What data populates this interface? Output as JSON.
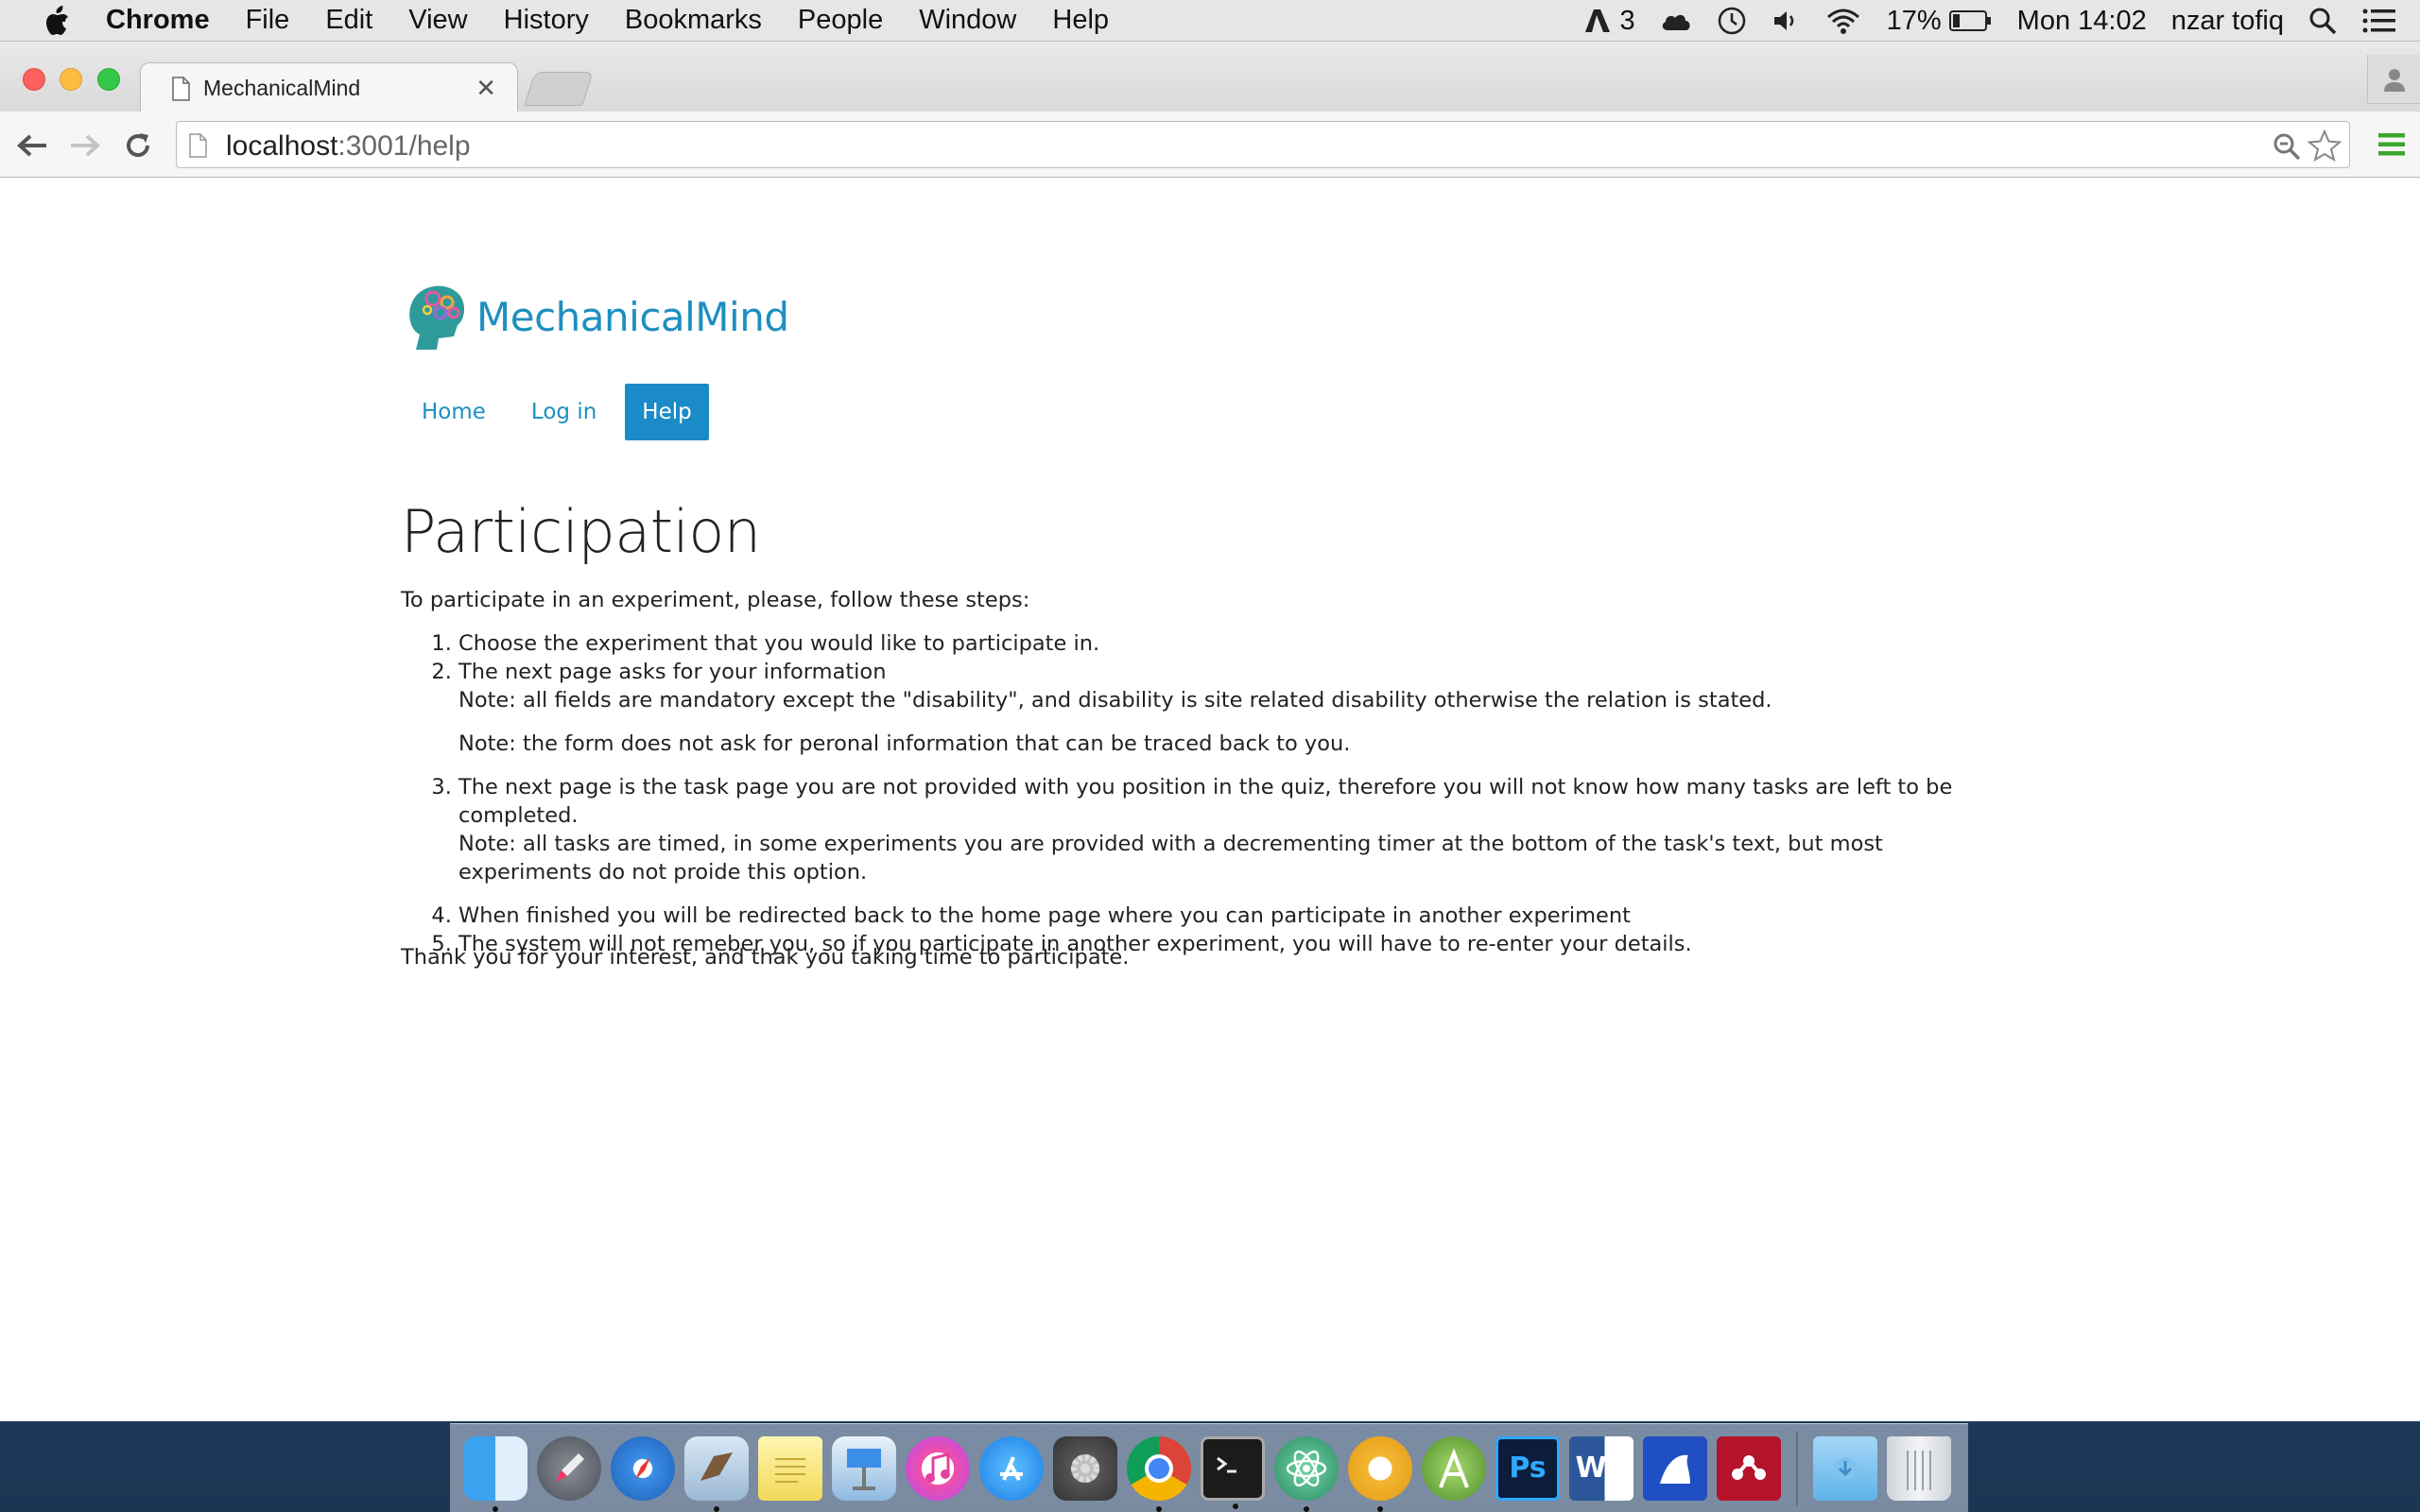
{
  "menubar": {
    "app": "Chrome",
    "items": [
      "File",
      "Edit",
      "View",
      "History",
      "Bookmarks",
      "People",
      "Window",
      "Help"
    ],
    "adobe_count": "3",
    "battery": "17%",
    "clock": "Mon 14:02",
    "user": "nzar tofiq"
  },
  "browser": {
    "tab_title": "MechanicalMind",
    "url_host": "localhost",
    "url_path": ":3001/help"
  },
  "page": {
    "brand": "MechanicalMind",
    "nav": [
      "Home",
      "Log in",
      "Help"
    ],
    "heading": "Participation",
    "intro": "To participate in an experiment, please, follow these steps:",
    "steps": {
      "s1": "Choose the experiment that you would like to participate in.",
      "s2": "The next page asks for your information",
      "s2_note1": "Note: all fields are mandatory except the \"disability\", and disability is site related disability otherwise the relation is stated.",
      "s2_note2": "Note: the form does not ask for peronal information that can be traced back to you.",
      "s3": "The next page is the task page you are not provided with you position in the quiz, therefore you will not know how many tasks are left to be completed.",
      "s3_note": "Note: all tasks are timed, in some experiments you are provided with a decrementing timer at the bottom of the task's text, but most experiments do not proide this option.",
      "s4": "When finished you will be redirected back to the home page where you can participate in another experiment",
      "s5": "The system will not remeber you, so if you participate in another experiment, you will have to re-enter your details."
    },
    "thanks": "Thank you for your interest, and thak you taking time to participate."
  },
  "dock": {
    "apps": [
      "finder-icon",
      "launchpad-icon",
      "safari-icon",
      "mail-icon",
      "notes-icon",
      "keynote-icon",
      "itunes-icon",
      "app-store-icon",
      "system-preferences-icon",
      "chrome-icon",
      "terminal-icon",
      "atom-icon",
      "chrome-canary-icon",
      "android-studio-icon",
      "photoshop-icon",
      "word-icon",
      "unknown-app-icon",
      "mendeley-icon",
      "downloads-folder-icon",
      "trash-icon"
    ],
    "photoshop_label": "Ps",
    "word_label": "W"
  },
  "colors": {
    "brand": "#1d8fc0",
    "nav_active_bg": "#1b8bc7"
  }
}
